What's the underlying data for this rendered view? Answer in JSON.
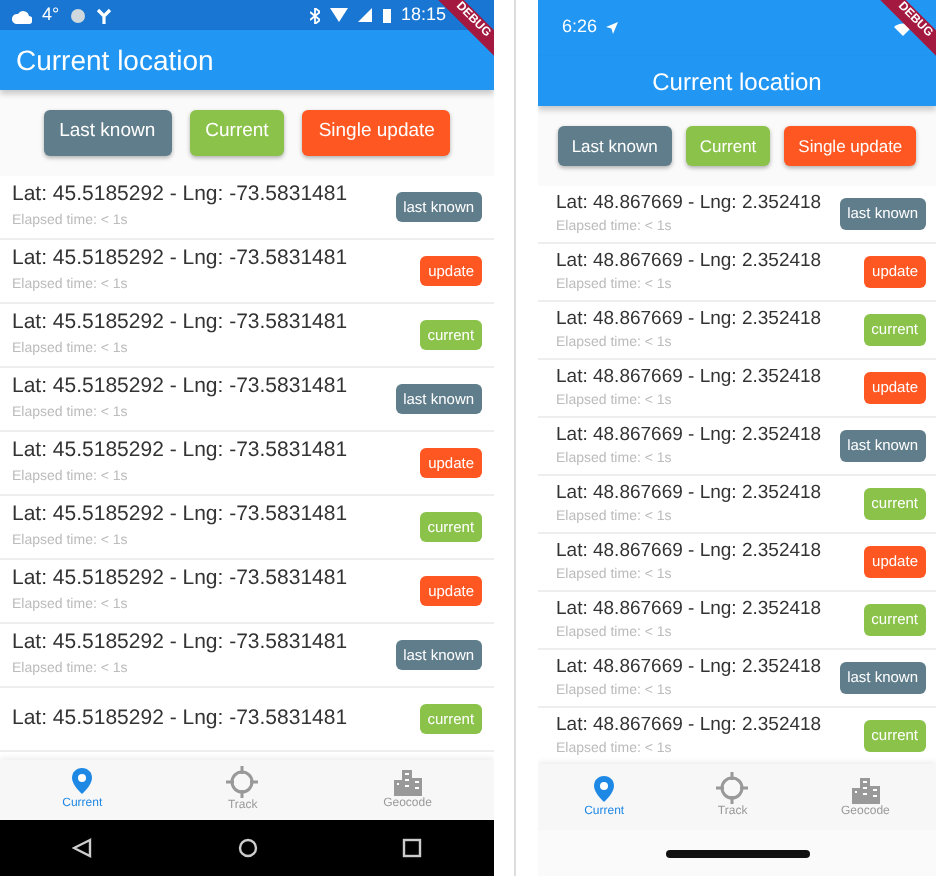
{
  "phones": [
    {
      "kind": "android",
      "status_bar": {
        "temperature": "4°",
        "time": "18:15"
      },
      "debug_banner": "DEBUG",
      "title": "Current location",
      "buttons": [
        {
          "label": "Last known",
          "kind": "last_known"
        },
        {
          "label": "Current",
          "kind": "current"
        },
        {
          "label": "Single update",
          "kind": "update"
        }
      ],
      "rows": [
        {
          "coords": "Lat: 45.5185292 - Lng: -73.5831481",
          "elapsed": "Elapsed time: < 1s",
          "badge": "last known",
          "kind": "last_known"
        },
        {
          "coords": "Lat: 45.5185292 - Lng: -73.5831481",
          "elapsed": "Elapsed time: < 1s",
          "badge": "update",
          "kind": "update"
        },
        {
          "coords": "Lat: 45.5185292 - Lng: -73.5831481",
          "elapsed": "Elapsed time: < 1s",
          "badge": "current",
          "kind": "current"
        },
        {
          "coords": "Lat: 45.5185292 - Lng: -73.5831481",
          "elapsed": "Elapsed time: < 1s",
          "badge": "last known",
          "kind": "last_known"
        },
        {
          "coords": "Lat: 45.5185292 - Lng: -73.5831481",
          "elapsed": "Elapsed time: < 1s",
          "badge": "update",
          "kind": "update"
        },
        {
          "coords": "Lat: 45.5185292 - Lng: -73.5831481",
          "elapsed": "Elapsed time: < 1s",
          "badge": "current",
          "kind": "current"
        },
        {
          "coords": "Lat: 45.5185292 - Lng: -73.5831481",
          "elapsed": "Elapsed time: < 1s",
          "badge": "update",
          "kind": "update"
        },
        {
          "coords": "Lat: 45.5185292 - Lng: -73.5831481",
          "elapsed": "Elapsed time: < 1s",
          "badge": "last known",
          "kind": "last_known"
        },
        {
          "coords": "Lat: 45.5185292 - Lng: -73.5831481",
          "badge": "current",
          "kind": "current"
        }
      ],
      "nav": [
        {
          "label": "Current",
          "kind": "pin",
          "selected": true
        },
        {
          "label": "Track",
          "kind": "target",
          "selected": false
        },
        {
          "label": "Geocode",
          "kind": "buildings",
          "selected": false
        }
      ]
    },
    {
      "kind": "ios",
      "status_bar": {
        "time": "6:26"
      },
      "debug_banner": "DEBUG",
      "title": "Current location",
      "buttons": [
        {
          "label": "Last known",
          "kind": "last_known"
        },
        {
          "label": "Current",
          "kind": "current"
        },
        {
          "label": "Single update",
          "kind": "update"
        }
      ],
      "rows": [
        {
          "coords": "Lat: 48.867669 - Lng: 2.352418",
          "elapsed": "Elapsed time: < 1s",
          "badge": "last known",
          "kind": "last_known"
        },
        {
          "coords": "Lat: 48.867669 - Lng: 2.352418",
          "elapsed": "Elapsed time: < 1s",
          "badge": "update",
          "kind": "update"
        },
        {
          "coords": "Lat: 48.867669 - Lng: 2.352418",
          "elapsed": "Elapsed time: < 1s",
          "badge": "current",
          "kind": "current"
        },
        {
          "coords": "Lat: 48.867669 - Lng: 2.352418",
          "elapsed": "Elapsed time: < 1s",
          "badge": "update",
          "kind": "update"
        },
        {
          "coords": "Lat: 48.867669 - Lng: 2.352418",
          "elapsed": "Elapsed time: < 1s",
          "badge": "last known",
          "kind": "last_known"
        },
        {
          "coords": "Lat: 48.867669 - Lng: 2.352418",
          "elapsed": "Elapsed time: < 1s",
          "badge": "current",
          "kind": "current"
        },
        {
          "coords": "Lat: 48.867669 - Lng: 2.352418",
          "elapsed": "Elapsed time: < 1s",
          "badge": "update",
          "kind": "update"
        },
        {
          "coords": "Lat: 48.867669 - Lng: 2.352418",
          "elapsed": "Elapsed time: < 1s",
          "badge": "current",
          "kind": "current"
        },
        {
          "coords": "Lat: 48.867669 - Lng: 2.352418",
          "elapsed": "Elapsed time: < 1s",
          "badge": "last known",
          "kind": "last_known"
        },
        {
          "coords": "Lat: 48.867669 - Lng: 2.352418",
          "elapsed": "Elapsed time: < 1s",
          "badge": "current",
          "kind": "current"
        }
      ],
      "nav": [
        {
          "label": "Current",
          "kind": "pin",
          "selected": true
        },
        {
          "label": "Track",
          "kind": "target",
          "selected": false
        },
        {
          "label": "Geocode",
          "kind": "buildings",
          "selected": false
        }
      ]
    }
  ]
}
